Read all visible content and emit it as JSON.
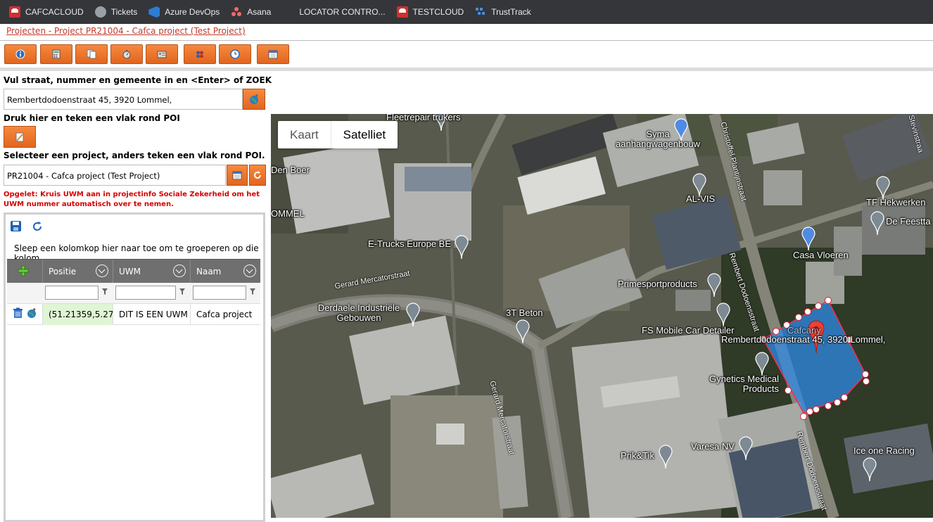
{
  "bookmarks": [
    {
      "label": "CAFCACLOUD",
      "icon": "cafca-icon"
    },
    {
      "label": "Tickets",
      "icon": "globe-icon"
    },
    {
      "label": "Azure DevOps",
      "icon": "azure-devops-icon"
    },
    {
      "label": "Asana",
      "icon": "asana-icon"
    },
    {
      "label": "LOCATOR CONTRO...",
      "icon": ""
    },
    {
      "label": "TESTCLOUD",
      "icon": "cafca-icon"
    },
    {
      "label": "TrustTrack",
      "icon": "trusttrack-icon"
    }
  ],
  "breadcrumb": "Projecten - Project PR21004 - Cafca project (Test Project)",
  "toolbar": {
    "icons": [
      "info-icon",
      "calculator-icon",
      "documents-icon",
      "stopwatch-icon",
      "id-card-icon",
      "people-icon",
      "clock-icon",
      "calendar-icon"
    ]
  },
  "search": {
    "label": "Vul straat, nummer en gemeente in en <Enter> of ZOEK",
    "value": "Rembertdodoenstraat 45, 3920 Lommel,"
  },
  "poi": {
    "label": "Druk hier en teken een vlak rond POI"
  },
  "project": {
    "label": "Selecteer een project, anders teken een vlak rond POI.",
    "value": "PR21004 - Cafca project (Test Project)"
  },
  "warning": "Opgelet: Kruis UWM aan in projectinfo Sociale Zekerheid om het UWM nummer automatisch over te nemen.",
  "grid": {
    "group_hint": "Sleep een kolomkop hier naar toe om te groeperen op die kolom",
    "columns": [
      "Positie",
      "UWM",
      "Naam"
    ],
    "row": {
      "positie": "(51.21359,5.27",
      "uwm": "DIT IS EEN UWM",
      "naam": "Cafca project"
    }
  },
  "map": {
    "types": [
      "Kaart",
      "Satelliet"
    ],
    "active_type": "Satelliet",
    "places": [
      "Fleetrepair trukers",
      "Syma aanhangwagenbouw",
      "Den Boer",
      "AL-VIS",
      "TF Hekwerken",
      "De Feestta",
      "OMMEL",
      "E-Trucks Europe BE",
      "Casa Vloeren",
      "Primesportproducts",
      "Derdaele Industriële Gebouwen",
      "3T Beton",
      "FS Mobile Car Detailer",
      "Rembertdodoenstraat 45, 3920 Lommel,",
      "Gynetics Medical Products",
      "Varesa NV",
      "Prik&Tik",
      "Ice one Racing",
      "Cafcany"
    ],
    "streets": [
      "Gerard Mercatorstraat",
      "Gerard Mercatorstraat",
      "Christoffel Plantijnstraat",
      "Rembert Dodoensstraat",
      "Rembert Dodoensstraat",
      "Stevinstraa"
    ]
  }
}
